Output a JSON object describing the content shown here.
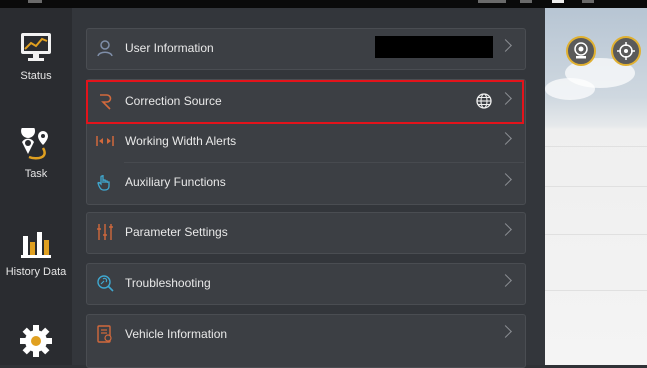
{
  "sidebar": {
    "items": [
      {
        "label": "Status",
        "icon": "monitor-chart-icon"
      },
      {
        "label": "Task",
        "icon": "route-pin-icon"
      },
      {
        "label": "History Data",
        "icon": "bar-chart-icon"
      },
      {
        "label": "",
        "icon": "gear-icon"
      }
    ]
  },
  "menu": {
    "items": [
      {
        "label": "User Information",
        "icon": "user-icon"
      },
      {
        "label": "Correction Source",
        "icon": "correction-source-icon",
        "status_icon": "globe-icon"
      },
      {
        "label": "Working Width Alerts",
        "icon": "width-arrows-icon"
      },
      {
        "label": "Auxiliary Functions",
        "icon": "hand-pointer-icon"
      },
      {
        "label": "Parameter Settings",
        "icon": "sliders-icon"
      },
      {
        "label": "Troubleshooting",
        "icon": "search-wrench-icon"
      },
      {
        "label": "Vehicle Information",
        "icon": "document-icon"
      }
    ]
  },
  "colors": {
    "accent": "#e3131b",
    "icon_orange": "#d2693c",
    "ring_gold": "#e0b030"
  }
}
